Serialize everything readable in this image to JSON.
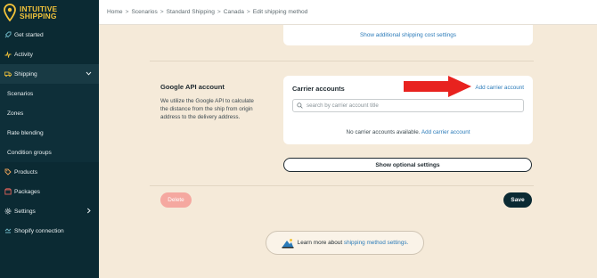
{
  "brand": {
    "line1": "INTUITIVE",
    "line2": "SHIPPING",
    "color": "#f2c33a"
  },
  "breadcrumb": [
    "Home",
    "Scenarios",
    "Standard Shipping",
    "Canada",
    "Edit shipping method"
  ],
  "breadcrumb_sep": ">",
  "sidebar": {
    "items": [
      {
        "label": "Get started",
        "icon": "rocket-icon"
      },
      {
        "label": "Activity",
        "icon": "activity-icon"
      },
      {
        "label": "Shipping",
        "icon": "truck-icon"
      },
      {
        "label": "Scenarios"
      },
      {
        "label": "Zones"
      },
      {
        "label": "Rate blending"
      },
      {
        "label": "Condition groups"
      },
      {
        "label": "Products",
        "icon": "tag-icon"
      },
      {
        "label": "Packages",
        "icon": "package-icon"
      },
      {
        "label": "Settings",
        "icon": "gear-icon"
      },
      {
        "label": "Shopify connection",
        "icon": "link-icon"
      }
    ]
  },
  "top_card": {
    "link": "Show additional shipping cost settings"
  },
  "google_api": {
    "title": "Google API account",
    "description": "We utilize the Google API to calculate the distance from the ship from origin address to the delivery address."
  },
  "carrier": {
    "title": "Carrier accounts",
    "add_link": "Add carrier account",
    "search_placeholder": "search by carrier account title",
    "empty_text": "No carrier accounts available.",
    "empty_link": "Add carrier account"
  },
  "buttons": {
    "optional": "Show optional settings",
    "delete": "Delete",
    "save": "Save"
  },
  "learn_more": {
    "prefix": "Learn more about",
    "link": "shipping method settings."
  },
  "colors": {
    "sidebar": "#0b2a33",
    "accent_link": "#2b7bb9",
    "arrow": "#e8221f",
    "delete": "#f5a8a0"
  }
}
